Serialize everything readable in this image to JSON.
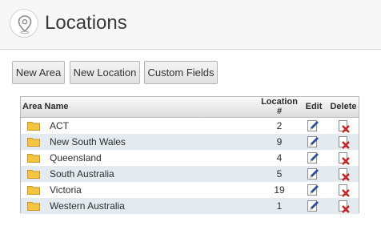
{
  "header": {
    "title": "Locations",
    "icon": "location-pin-icon"
  },
  "toolbar": {
    "new_area": "New Area",
    "new_location": "New Location",
    "custom_fields": "Custom Fields"
  },
  "grid": {
    "columns": {
      "area_name": "Area Name",
      "location_count_line1": "Location",
      "location_count_line2": "#",
      "edit": "Edit",
      "delete": "Delete"
    },
    "rows": [
      {
        "name": "ACT",
        "count": "2"
      },
      {
        "name": "New South Wales",
        "count": "9"
      },
      {
        "name": "Queensland",
        "count": "4"
      },
      {
        "name": "South Australia",
        "count": "5"
      },
      {
        "name": "Victoria",
        "count": "19"
      },
      {
        "name": "Western Australia",
        "count": "1"
      }
    ],
    "icons": {
      "folder": "folder-icon",
      "edit": "edit-pencil-icon",
      "delete": "delete-x-icon"
    },
    "colors": {
      "alt_row": "#e4ebf0",
      "folder": "#f5c542",
      "delete": "#cc1f1f",
      "pencil": "#2b4fa0"
    }
  }
}
